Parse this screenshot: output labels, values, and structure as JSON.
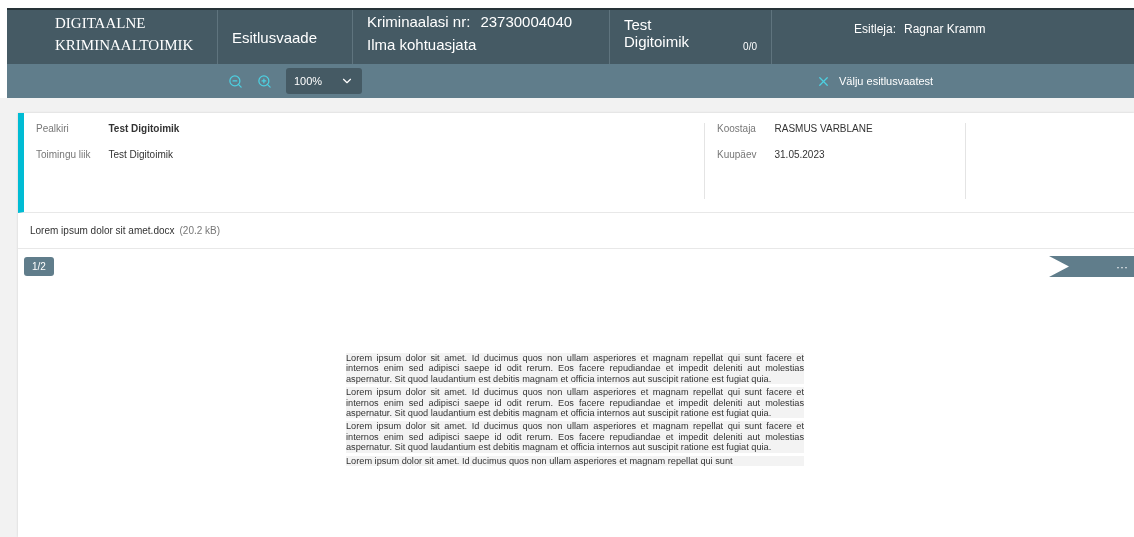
{
  "header": {
    "logo": [
      "DIGITAALNE",
      "KRIMINAALTOIMIK"
    ],
    "view_title": "Esitlusvaade",
    "case_label": "Kriminaalasi nr:",
    "case_number": "23730004040",
    "case_subtitle": "Ilma kohtuasjata",
    "folder_title": "Test Digitoimik",
    "folder_count": "0/0",
    "presenter_label": "Esitleja:",
    "presenter_name": "Ragnar Kramm"
  },
  "toolbar": {
    "zoom": "100%",
    "exit": "Välju esitlusvaatest"
  },
  "details": {
    "left": [
      {
        "label": "Pealkiri",
        "value": "Test Digitoimik",
        "bold": true
      },
      {
        "label": "Toimingu liik",
        "value": "Test Digitoimik",
        "bold": false
      }
    ],
    "right": [
      {
        "label": "Koostaja",
        "value": "RASMUS VARBLANE"
      },
      {
        "label": "Kuupäev",
        "value": "31.05.2023"
      }
    ]
  },
  "file": {
    "name": "Lorem ipsum dolor sit amet.docx",
    "size": "(20.2 kB)"
  },
  "viewer": {
    "page": "1/2",
    "more": "···"
  },
  "document": {
    "paragraphs": [
      "Lorem ipsum dolor sit amet. Id ducimus quos non ullam asperiores et magnam repellat qui sunt facere et internos enim sed adipisci saepe id odit rerum. Eos facere repudiandae et impedit deleniti aut molestias aspernatur. Sit quod laudantium est debitis magnam et officia internos aut suscipit ratione est fugiat quia.",
      "Lorem ipsum dolor sit amet. Id ducimus quos non ullam asperiores et magnam repellat qui sunt facere et internos enim sed adipisci saepe id odit rerum. Eos facere repudiandae et impedit deleniti aut molestias aspernatur. Sit quod laudantium est debitis magnam et officia internos aut suscipit ratione est fugiat quia.",
      "Lorem ipsum dolor sit amet. Id ducimus quos non ullam asperiores et magnam repellat qui sunt facere et internos enim sed adipisci saepe id odit rerum. Eos facere repudiandae et impedit deleniti aut molestias aspernatur. Sit quod laudantium est debitis magnam et officia internos aut suscipit ratione est fugiat quia.",
      "Lorem ipsum dolor sit amet. Id ducimus quos non ullam asperiores et magnam repellat qui sunt"
    ]
  }
}
